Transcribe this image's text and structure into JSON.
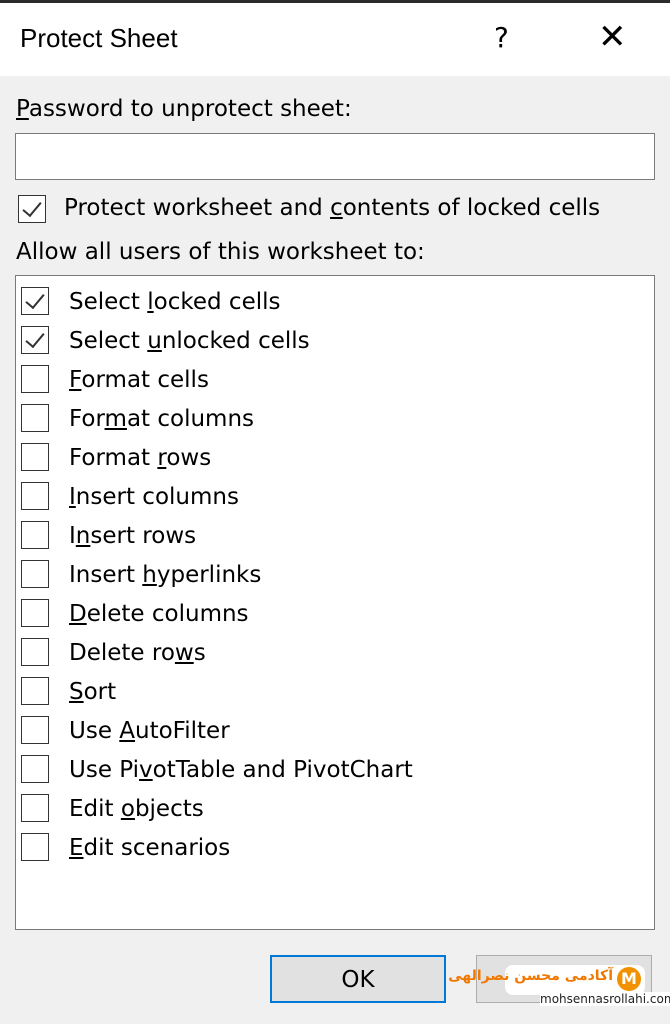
{
  "dialog": {
    "title": "Protect Sheet",
    "help": "?",
    "close": "✕"
  },
  "password": {
    "label": [
      "",
      "P",
      "assword to unprotect sheet:"
    ],
    "value": ""
  },
  "protect": {
    "label": [
      "Protect worksheet and ",
      "c",
      "ontents of locked cells"
    ],
    "checked": true
  },
  "allow_label": "Allow all users of this worksheet to:",
  "items": [
    {
      "parts": [
        "Select ",
        "l",
        "ocked cells"
      ],
      "checked": true
    },
    {
      "parts": [
        "Select ",
        "u",
        "nlocked cells"
      ],
      "checked": true
    },
    {
      "parts": [
        "",
        "F",
        "ormat cells"
      ],
      "checked": false
    },
    {
      "parts": [
        "For",
        "m",
        "at columns"
      ],
      "checked": false
    },
    {
      "parts": [
        "Format ",
        "r",
        "ows"
      ],
      "checked": false
    },
    {
      "parts": [
        "",
        "I",
        "nsert columns"
      ],
      "checked": false
    },
    {
      "parts": [
        "I",
        "n",
        "sert rows"
      ],
      "checked": false
    },
    {
      "parts": [
        "Insert ",
        "h",
        "yperlinks"
      ],
      "checked": false
    },
    {
      "parts": [
        "",
        "D",
        "elete columns"
      ],
      "checked": false
    },
    {
      "parts": [
        "Delete ro",
        "w",
        "s"
      ],
      "checked": false
    },
    {
      "parts": [
        "",
        "S",
        "ort"
      ],
      "checked": false
    },
    {
      "parts": [
        "Use ",
        "A",
        "utoFilter"
      ],
      "checked": false
    },
    {
      "parts": [
        "Use Pi",
        "v",
        "otTable and PivotChart"
      ],
      "checked": false
    },
    {
      "parts": [
        "Edit ",
        "o",
        "bjects"
      ],
      "checked": false
    },
    {
      "parts": [
        "",
        "E",
        "dit scenarios"
      ],
      "checked": false
    }
  ],
  "buttons": {
    "ok": "OK",
    "cancel": "Cancel"
  },
  "watermark": {
    "logo_text": "آکادمی محسن نصرالهی",
    "url": "mohsennasrollahi.com"
  },
  "colors": {
    "accent": "#0078d7",
    "logo": "#f29100"
  }
}
